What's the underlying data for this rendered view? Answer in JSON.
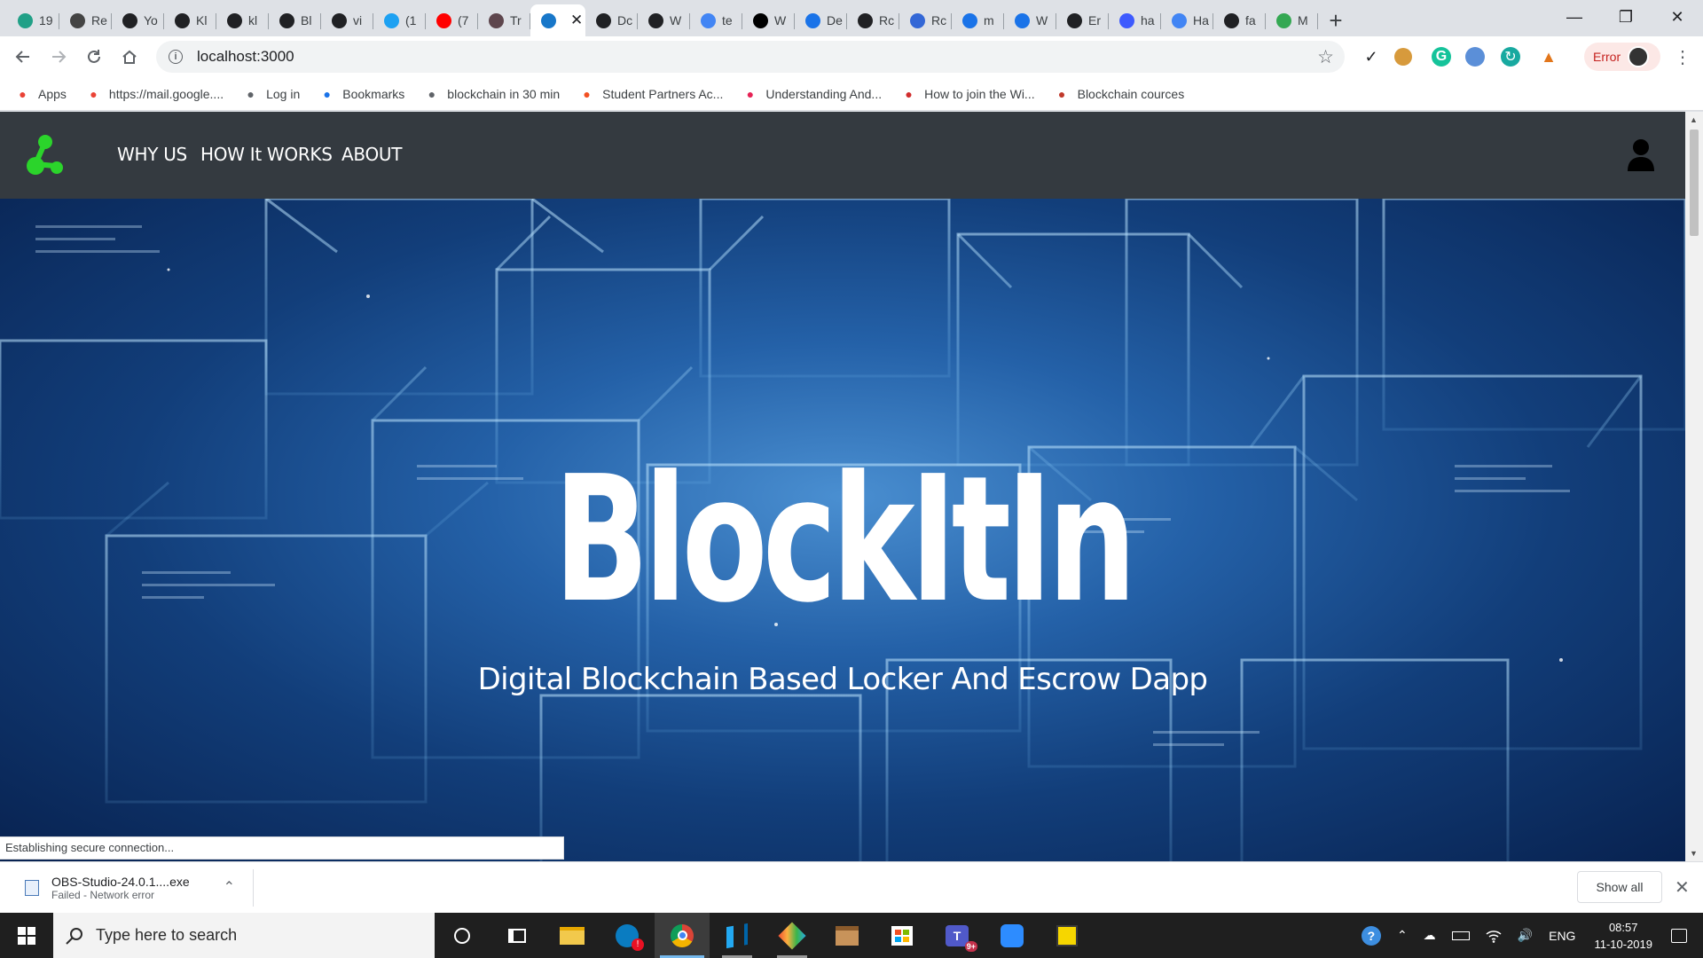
{
  "browser": {
    "tabs": [
      {
        "title": "19",
        "icon": "wordpress-icon",
        "color": "#21a087"
      },
      {
        "title": "Re",
        "icon": "remix-icon",
        "color": "#444444"
      },
      {
        "title": "Yo",
        "icon": "github-icon",
        "color": "#202124"
      },
      {
        "title": "Kl",
        "icon": "globe-icon",
        "color": "#202124"
      },
      {
        "title": "kl",
        "icon": "github-icon",
        "color": "#202124"
      },
      {
        "title": "Bl",
        "icon": "github-icon",
        "color": "#202124"
      },
      {
        "title": "vi",
        "icon": "github-icon",
        "color": "#202124"
      },
      {
        "title": "(1",
        "icon": "twitter-icon",
        "color": "#1da1f2"
      },
      {
        "title": "(7",
        "icon": "youtube-icon",
        "color": "#ff0000"
      },
      {
        "title": "Tr",
        "icon": "truffle-icon",
        "color": "#5e464d"
      },
      {
        "title": "",
        "icon": "react-app-icon",
        "color": "#1877c9",
        "active": true
      },
      {
        "title": "Dc",
        "icon": "globe-icon",
        "color": "#202124"
      },
      {
        "title": "W",
        "icon": "globe-icon",
        "color": "#202124"
      },
      {
        "title": "te",
        "icon": "google-icon",
        "color": "#4285f4"
      },
      {
        "title": "W",
        "icon": "medium-icon",
        "color": "#000000"
      },
      {
        "title": "De",
        "icon": "metamask-m-icon",
        "color": "#1a73e8"
      },
      {
        "title": "Rc",
        "icon": "anchor-icon",
        "color": "#202124"
      },
      {
        "title": "Rc",
        "icon": "wp-icon",
        "color": "#3367d6"
      },
      {
        "title": "m",
        "icon": "metamask-m-icon",
        "color": "#1a73e8"
      },
      {
        "title": "W",
        "icon": "metamask-m-icon",
        "color": "#1a73e8"
      },
      {
        "title": "Er",
        "icon": "github-icon",
        "color": "#202124"
      },
      {
        "title": "ha",
        "icon": "bookmark-blue-icon",
        "color": "#3d5afe"
      },
      {
        "title": "Ha",
        "icon": "docs-icon",
        "color": "#4285f4"
      },
      {
        "title": "fa",
        "icon": "image-icon",
        "color": "#202124"
      },
      {
        "title": "M",
        "icon": "drive-icon",
        "color": "#34a853"
      }
    ],
    "active_tab_close": "✕",
    "new_tab": "+",
    "url": "localhost:3000",
    "error_label": "Error",
    "bookmarks": [
      {
        "label": "Apps",
        "icon": "apps-grid-icon",
        "color": "#e94235"
      },
      {
        "label": "https://mail.google....",
        "icon": "gmail-icon",
        "color": "#ea4335"
      },
      {
        "label": "Log in",
        "icon": "page-icon",
        "color": "#5f6368"
      },
      {
        "label": "Bookmarks",
        "icon": "star-icon",
        "color": "#1a73e8"
      },
      {
        "label": "blockchain in 30 min",
        "icon": "globe-icon",
        "color": "#5f6368"
      },
      {
        "label": "Student Partners Ac...",
        "icon": "microsoft-icon",
        "color": "#f25022"
      },
      {
        "label": "Understanding And...",
        "icon": "play-circle-icon",
        "color": "#e62255"
      },
      {
        "label": "How to join the Wi...",
        "icon": "w-icon",
        "color": "#d12d2d"
      },
      {
        "label": "Blockchain cources",
        "icon": "b9lab-icon",
        "color": "#c0392b"
      }
    ],
    "status_text": "Establishing secure connection..."
  },
  "site": {
    "nav": {
      "links": [
        "WHY US",
        "HOW It WORKS",
        "ABOUT"
      ],
      "logo_color": "#2bd42b"
    },
    "hero": {
      "title": "BlockItIn",
      "subtitle": "Digital Blockchain Based Locker And Escrow Dapp"
    }
  },
  "downloads": {
    "file_name": "OBS-Studio-24.0.1....exe",
    "status": "Failed - Network error",
    "show_all": "Show all"
  },
  "taskbar": {
    "search_placeholder": "Type here to search",
    "language": "ENG",
    "time": "08:57",
    "date": "11-10-2019",
    "teams_badge": "9+"
  }
}
